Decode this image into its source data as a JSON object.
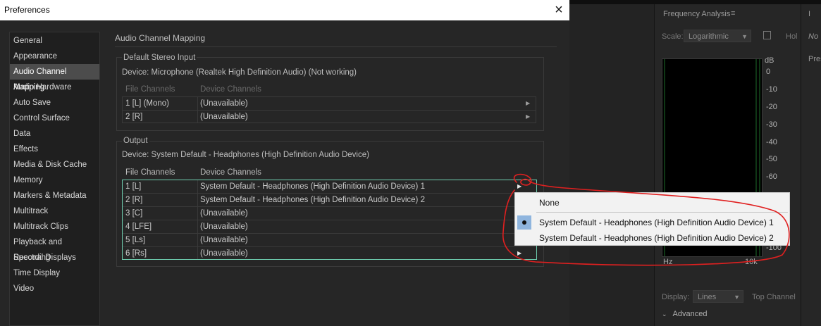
{
  "dialog": {
    "title": "Preferences",
    "close_icon": "×"
  },
  "sidebar": {
    "items": [
      {
        "label": "General"
      },
      {
        "label": "Appearance"
      },
      {
        "label": "Audio Channel Mapping",
        "selected": true
      },
      {
        "label": "Audio Hardware"
      },
      {
        "label": "Auto Save"
      },
      {
        "label": "Control Surface"
      },
      {
        "label": "Data"
      },
      {
        "label": "Effects"
      },
      {
        "label": "Media & Disk Cache"
      },
      {
        "label": "Memory"
      },
      {
        "label": "Markers & Metadata"
      },
      {
        "label": "Multitrack"
      },
      {
        "label": "Multitrack Clips"
      },
      {
        "label": "Playback and Recording"
      },
      {
        "label": "Spectral Displays"
      },
      {
        "label": "Time Display"
      },
      {
        "label": "Video"
      }
    ]
  },
  "content": {
    "title": "Audio Channel Mapping",
    "input": {
      "group_title": "Default Stereo Input",
      "device": "Device: Microphone (Realtek High Definition Audio) (Not working)",
      "col_file": "File Channels",
      "col_device": "Device Channels",
      "rows": [
        {
          "file": "1 [L] (Mono)",
          "device": "(Unavailable)"
        },
        {
          "file": "2 [R]",
          "device": "(Unavailable)"
        }
      ]
    },
    "output": {
      "group_title": "Output",
      "device": "Device: System Default - Headphones (High Definition Audio Device)",
      "col_file": "File Channels",
      "col_device": "Device Channels",
      "rows": [
        {
          "file": "1 [L]",
          "device": "System Default - Headphones (High Definition Audio Device) 1"
        },
        {
          "file": "2 [R]",
          "device": "System Default - Headphones (High Definition Audio Device) 2"
        },
        {
          "file": "3 [C]",
          "device": "(Unavailable)"
        },
        {
          "file": "4 [LFE]",
          "device": "(Unavailable)"
        },
        {
          "file": "5 [Ls]",
          "device": "(Unavailable)"
        },
        {
          "file": "6 [Rs]",
          "device": "(Unavailable)"
        }
      ]
    }
  },
  "dropdown": {
    "options": [
      {
        "label": "None"
      },
      {
        "label": "System Default - Headphones (High Definition Audio Device) 1",
        "selected": true
      },
      {
        "label": "System Default - Headphones (High Definition Audio Device) 2"
      }
    ]
  },
  "background_panel": {
    "frequency_analysis": {
      "title": "Frequency Analysis",
      "scale_label": "Scale:",
      "scale_value": "Logarithmic",
      "hold_label": "Hol",
      "db_unit": "dB",
      "db_ticks": [
        "0",
        "-10",
        "-20",
        "-30",
        "-40",
        "-50",
        "-60",
        "-100"
      ],
      "x_start": "Hz",
      "x_end": "10k",
      "display_label": "Display:",
      "display_value": "Lines",
      "top_channel_label": "Top Channel",
      "advanced_label": "Advanced"
    },
    "right_strip": {
      "no_label": "No",
      "pres_label": "Pres",
      "i_label": "I"
    }
  },
  "colors": {
    "dialog_bg": "#262626",
    "selected_item": "#4c4c4c",
    "output_table_border": "#6fcfb0",
    "menu_selection": "#8fb5de",
    "annotation_red": "#e02020"
  }
}
